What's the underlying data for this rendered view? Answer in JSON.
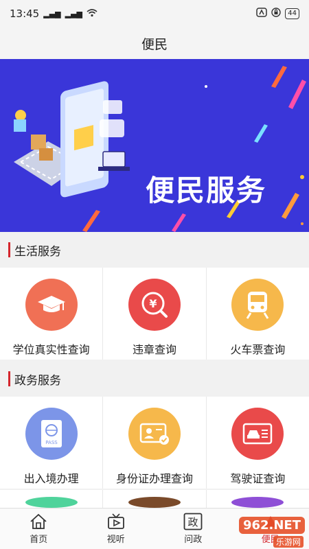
{
  "status": {
    "time": "13:45",
    "signal1": "5G",
    "signal2": "5G",
    "battery": "44"
  },
  "header": {
    "title": "便民"
  },
  "banner": {
    "title": "便民服务"
  },
  "sections": [
    {
      "title": "生活服务",
      "items": [
        {
          "label": "学位真实性查询",
          "icon": "graduation-cap-icon",
          "color": "#f07055"
        },
        {
          "label": "违章查询",
          "icon": "traffic-violation-icon",
          "color": "#e94a4a"
        },
        {
          "label": "火车票查询",
          "icon": "train-icon",
          "color": "#f6b84b"
        }
      ]
    },
    {
      "title": "政务服务",
      "items": [
        {
          "label": "出入境办理",
          "icon": "passport-icon",
          "color": "#7c95e8"
        },
        {
          "label": "身份证办理查询",
          "icon": "id-card-icon",
          "color": "#f6b84b"
        },
        {
          "label": "驾驶证查询",
          "icon": "driver-license-icon",
          "color": "#e94a4a"
        }
      ]
    }
  ],
  "bottom_nav": [
    {
      "label": "首页",
      "icon": "home-icon"
    },
    {
      "label": "视听",
      "icon": "tv-icon"
    },
    {
      "label": "问政",
      "icon": "zheng-icon"
    },
    {
      "label": "便民",
      "icon": "service-icon",
      "active": true
    }
  ],
  "watermark": {
    "brand": "962.NET",
    "sub": "乐游网"
  }
}
